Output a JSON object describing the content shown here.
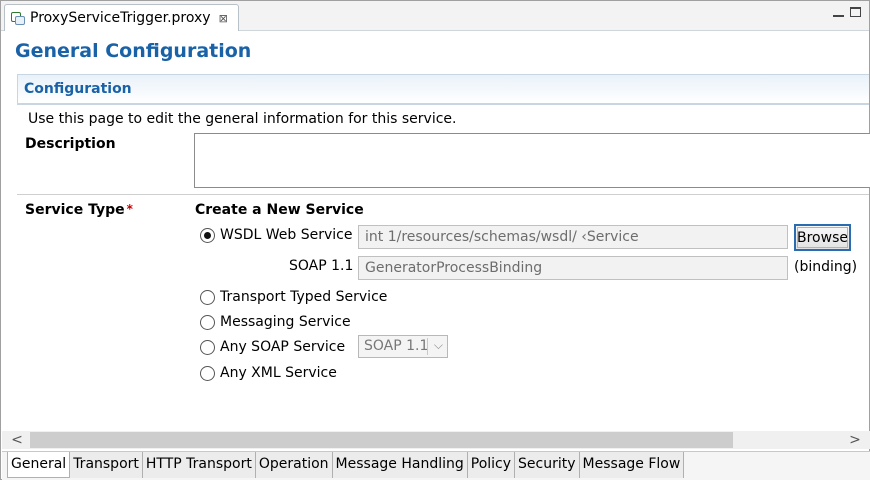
{
  "editor": {
    "tab_title": "ProxyServiceTrigger.proxy",
    "close_glyph": "⊠"
  },
  "page": {
    "title": "General Configuration"
  },
  "section": {
    "title": "Configuration",
    "description": "Use this page to edit the general information for this service."
  },
  "form": {
    "description_label": "Description",
    "description_value": "",
    "service_type_label": "Service Type",
    "required_marker": "*",
    "create_heading": "Create a New Service",
    "wsdl": {
      "label": "WSDL Web Service",
      "selected": true,
      "path_value": "int               1/resources/schemas/wsdl/                            ‹Service",
      "browse_label": "Browse",
      "soap_label": "SOAP 1.1",
      "binding_value": "                                          GeneratorProcessBinding",
      "binding_suffix": "(binding)"
    },
    "options": [
      {
        "label": "Transport Typed Service",
        "selected": false
      },
      {
        "label": "Messaging Service",
        "selected": false
      },
      {
        "label": "Any SOAP Service",
        "selected": false
      },
      {
        "label": "Any XML Service",
        "selected": false
      }
    ],
    "soap_version_select": {
      "value": "SOAP 1.1",
      "chevron": "⌵"
    }
  },
  "scrollbar": {
    "left_arrow": "<",
    "right_arrow": ">"
  },
  "bottom_tabs": [
    "General",
    "Transport",
    "HTTP Transport",
    "Operation",
    "Message Handling",
    "Policy",
    "Security",
    "Message Flow"
  ],
  "colors": {
    "heading_blue": "#1a62a8",
    "required_red": "#c00000",
    "focus_blue": "#2b6cb0"
  },
  "icons": {
    "editor_tab": "proxy-service-icon",
    "minimize": "minimize-icon",
    "maximize": "maximize-icon"
  }
}
